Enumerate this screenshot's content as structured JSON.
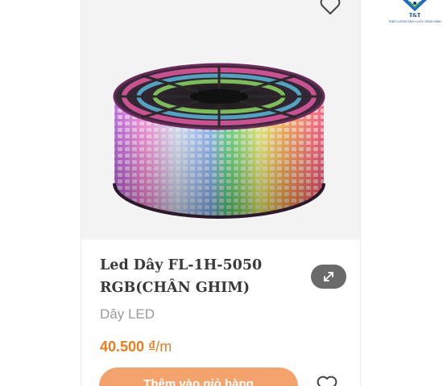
{
  "logo": {
    "name": "T&T",
    "tagline": "THẮP LƯỚNG SÁCH LUÔC SỐNG XANH"
  },
  "product": {
    "title": "Led Dây FL-1H-5050 RGB(CHÂN GHIM)",
    "category": "Dây LED",
    "price": "40.500 ₫",
    "unit": "/m",
    "add_to_cart_label": "Thêm vào giỏ hàng"
  },
  "icons": {
    "wishlist_top": "heart-icon",
    "quick_view": "expand-icon",
    "wishlist_bottom": "heart-icon"
  },
  "colors": {
    "price": "#e67e22",
    "button": "#f4a36c",
    "title": "#3a3a3a",
    "category": "#9a9a9a"
  }
}
